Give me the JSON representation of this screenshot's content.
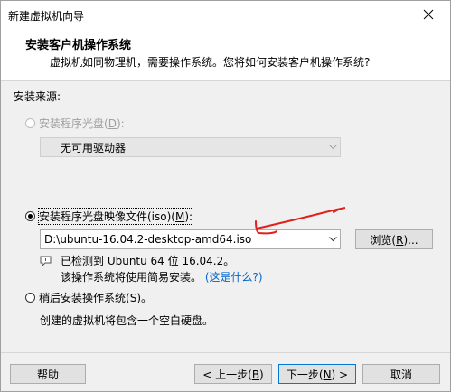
{
  "window": {
    "title": "新建虚拟机向导"
  },
  "header": {
    "title": "安装客户机操作系统",
    "subtitle": "虚拟机如同物理机，需要操作系统。您将如何安装客户机操作系统?"
  },
  "source": {
    "label": "安装来源:",
    "disc_option": {
      "label_pre": "安装程序光盘(",
      "key": "D",
      "label_post": "):",
      "selected": false,
      "enabled": false
    },
    "disc_drive": {
      "value": "无可用驱动器"
    },
    "iso_option": {
      "label_pre": "安装程序光盘映像文件(iso)(",
      "key": "M",
      "label_post": "):",
      "selected": true
    },
    "iso_path": {
      "value": "D:\\ubuntu-16.04.2-desktop-amd64.iso"
    },
    "browse_button": {
      "label_pre": "浏览(",
      "key": "R",
      "label_post": ")..."
    },
    "detected": {
      "line1": "已检测到 Ubuntu 64 位 16.04.2。",
      "line2": "该操作系统将使用简易安装。",
      "link": "(这是什么?)"
    },
    "later_option": {
      "label_pre": "稍后安装操作系统(",
      "key": "S",
      "label_post": ")。",
      "selected": false
    },
    "later_desc": "创建的虚拟机将包含一个空白硬盘。"
  },
  "footer": {
    "help": "帮助",
    "back": {
      "label_pre": "< 上一步(",
      "key": "B",
      "label_post": ")"
    },
    "next": {
      "label_pre": "下一步(",
      "key": "N",
      "label_post": ") >"
    },
    "cancel": "取消"
  },
  "colors": {
    "annotation_red": "#e0201b",
    "link": "#0066cc",
    "focus_border": "#0078d7"
  },
  "icons": {
    "close": "close-icon",
    "dropdown": "chevron-down-icon",
    "info": "speech-bubble-icon"
  }
}
